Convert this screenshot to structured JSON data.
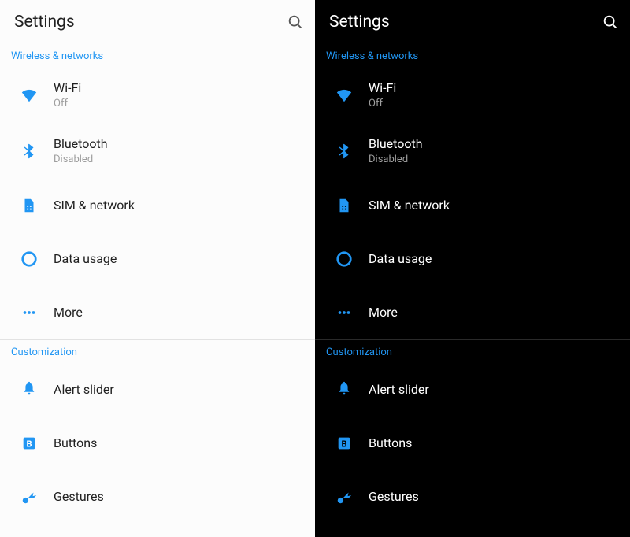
{
  "themes": [
    "light",
    "dark"
  ],
  "header": {
    "title_light": "Settings",
    "title_dark": "Settings"
  },
  "section1": {
    "label_light": "Wireless & networks",
    "label_dark": "Wireless & networks"
  },
  "wifi": {
    "title_light": "Wi-Fi",
    "title_dark": "Wi-Fi",
    "sub_light": "Off",
    "sub_dark": "Off"
  },
  "bluetooth": {
    "title_light": "Bluetooth",
    "title_dark": "Bluetooth",
    "sub_light": "Disabled",
    "sub_dark": "Disabled"
  },
  "sim": {
    "title_light": "SIM & network",
    "title_dark": "SIM & network"
  },
  "data": {
    "title_light": "Data usage",
    "title_dark": "Data usage"
  },
  "more": {
    "title_light": "More",
    "title_dark": "More"
  },
  "section2": {
    "label_light": "Customization",
    "label_dark": "Customization"
  },
  "alert": {
    "title_light": "Alert slider",
    "title_dark": "Alert slider"
  },
  "buttons": {
    "title_light": "Buttons",
    "title_dark": "Buttons"
  },
  "gestures": {
    "title_light": "Gestures",
    "title_dark": "Gestures"
  },
  "accent": "#2196f3"
}
